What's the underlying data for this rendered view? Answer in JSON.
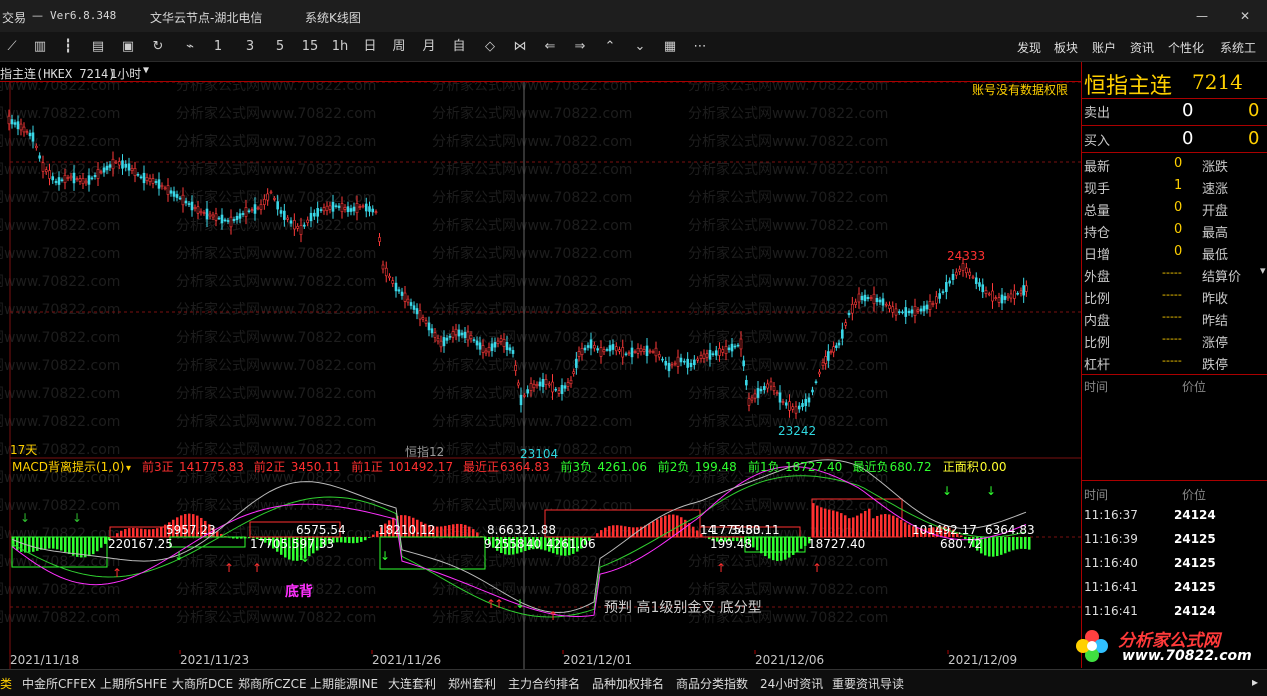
{
  "titlebar": {
    "app": "交易",
    "version": "Ver6.8.348",
    "server": "文华云节点-湖北电信",
    "menu": "系统K线图"
  },
  "toolbar": {
    "period_labels": [
      "1",
      "3",
      "5",
      "15",
      "1h",
      "日",
      "周",
      "月",
      "自"
    ],
    "right_menu": [
      "发现",
      "板块",
      "账户",
      "资讯",
      "个性化",
      "系统工"
    ]
  },
  "subbar": {
    "instrument": "指主连(HKEX 7214)",
    "period": "1小时"
  },
  "chart": {
    "no_permission": "账号没有数据权限",
    "high_label": "24333",
    "low_label_1": "23104",
    "low_label_2": "23242",
    "days_label": "17天",
    "sub_name": "恒指12",
    "dates": [
      "2021/11/18",
      "2021/11/23",
      "2021/11/26",
      "2021/12/01",
      "2021/12/06",
      "2021/12/09"
    ],
    "watermark": "分析家公式网www.70822.com"
  },
  "macd": {
    "title": "MACD背离提示(1,0)",
    "stats": [
      {
        "label": "前3正",
        "value": "141775.83",
        "color": "#ff3030"
      },
      {
        "label": "前2正",
        "value": "3450.11",
        "color": "#ff3030"
      },
      {
        "label": "前1正",
        "value": "101492.17",
        "color": "#ff3030"
      },
      {
        "label": "最近正",
        "value": "6364.83",
        "color": "#ff3030"
      },
      {
        "label": "前3负",
        "value": "4261.06",
        "color": "#30ff30"
      },
      {
        "label": "前2负",
        "value": "199.48",
        "color": "#30ff30"
      },
      {
        "label": "前1负",
        "value": "18727.40",
        "color": "#30ff30"
      },
      {
        "label": "最近负",
        "value": "680.72",
        "color": "#30ff30"
      },
      {
        "label": "正面积",
        "value": "0.00",
        "color": "#ffff30"
      }
    ],
    "box_labels": [
      "5957.23",
      "6575.54",
      "18210.12",
      "8.66",
      "321.88",
      "14",
      "1775.83",
      "3450.11",
      "101492.17",
      "6364.83",
      "220167.25",
      "17705.597.33",
      "9",
      "2558",
      "40",
      "4261.06",
      "199.48",
      "18727.40",
      "680.72"
    ],
    "text_dibei": "底背",
    "text_yupan": "预判  高1级别金叉  底分型"
  },
  "quote": {
    "name": "恒指主连",
    "code": "7214",
    "sell_label": "卖出",
    "sell_price": "0",
    "sell_vol": "0",
    "buy_label": "买入",
    "buy_price": "0",
    "buy_vol": "0",
    "rows": [
      {
        "l": "最新",
        "v": "0",
        "r": "涨跌"
      },
      {
        "l": "现手",
        "v": "1",
        "r": "速涨"
      },
      {
        "l": "总量",
        "v": "0",
        "r": "开盘"
      },
      {
        "l": "持仓",
        "v": "0",
        "r": "最高"
      },
      {
        "l": "日增",
        "v": "0",
        "r": "最低"
      },
      {
        "l": "外盘",
        "v": "-----",
        "r": "结算价"
      },
      {
        "l": "比例",
        "v": "-----",
        "r": "昨收"
      },
      {
        "l": "内盘",
        "v": "-----",
        "r": "昨结"
      },
      {
        "l": "比例",
        "v": "-----",
        "r": "涨停"
      },
      {
        "l": "杠杆",
        "v": "-----",
        "r": "跌停"
      }
    ],
    "header_time": "时间",
    "header_price": "价位",
    "ticks": [
      {
        "t": "11:16:37",
        "p": "24124"
      },
      {
        "t": "11:16:39",
        "p": "24125"
      },
      {
        "t": "11:16:40",
        "p": "24125"
      },
      {
        "t": "11:16:41",
        "p": "24125"
      },
      {
        "t": "11:16:41",
        "p": "24124"
      }
    ],
    "brand": "分析家公式网",
    "brand_url": "www.70822.com"
  },
  "statusbar": {
    "items": [
      "类",
      "中金所CFFEX",
      "上期所SHFE",
      "大商所DCE",
      "郑商所CZCE",
      "上期能源INE",
      "大连套利",
      "郑州套利",
      "主力合约排名",
      "品种加权排名",
      "商品分类指数",
      "24小时资讯",
      "重要资讯导读"
    ]
  }
}
